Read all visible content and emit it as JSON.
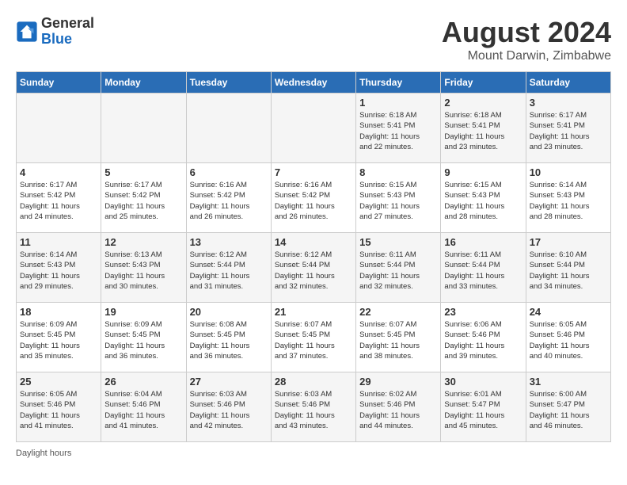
{
  "header": {
    "logo_general": "General",
    "logo_blue": "Blue",
    "month_year": "August 2024",
    "location": "Mount Darwin, Zimbabwe"
  },
  "columns": [
    "Sunday",
    "Monday",
    "Tuesday",
    "Wednesday",
    "Thursday",
    "Friday",
    "Saturday"
  ],
  "weeks": [
    [
      {
        "day": "",
        "info": ""
      },
      {
        "day": "",
        "info": ""
      },
      {
        "day": "",
        "info": ""
      },
      {
        "day": "",
        "info": ""
      },
      {
        "day": "1",
        "info": "Sunrise: 6:18 AM\nSunset: 5:41 PM\nDaylight: 11 hours\nand 22 minutes."
      },
      {
        "day": "2",
        "info": "Sunrise: 6:18 AM\nSunset: 5:41 PM\nDaylight: 11 hours\nand 23 minutes."
      },
      {
        "day": "3",
        "info": "Sunrise: 6:17 AM\nSunset: 5:41 PM\nDaylight: 11 hours\nand 23 minutes."
      }
    ],
    [
      {
        "day": "4",
        "info": "Sunrise: 6:17 AM\nSunset: 5:42 PM\nDaylight: 11 hours\nand 24 minutes."
      },
      {
        "day": "5",
        "info": "Sunrise: 6:17 AM\nSunset: 5:42 PM\nDaylight: 11 hours\nand 25 minutes."
      },
      {
        "day": "6",
        "info": "Sunrise: 6:16 AM\nSunset: 5:42 PM\nDaylight: 11 hours\nand 26 minutes."
      },
      {
        "day": "7",
        "info": "Sunrise: 6:16 AM\nSunset: 5:42 PM\nDaylight: 11 hours\nand 26 minutes."
      },
      {
        "day": "8",
        "info": "Sunrise: 6:15 AM\nSunset: 5:43 PM\nDaylight: 11 hours\nand 27 minutes."
      },
      {
        "day": "9",
        "info": "Sunrise: 6:15 AM\nSunset: 5:43 PM\nDaylight: 11 hours\nand 28 minutes."
      },
      {
        "day": "10",
        "info": "Sunrise: 6:14 AM\nSunset: 5:43 PM\nDaylight: 11 hours\nand 28 minutes."
      }
    ],
    [
      {
        "day": "11",
        "info": "Sunrise: 6:14 AM\nSunset: 5:43 PM\nDaylight: 11 hours\nand 29 minutes."
      },
      {
        "day": "12",
        "info": "Sunrise: 6:13 AM\nSunset: 5:43 PM\nDaylight: 11 hours\nand 30 minutes."
      },
      {
        "day": "13",
        "info": "Sunrise: 6:12 AM\nSunset: 5:44 PM\nDaylight: 11 hours\nand 31 minutes."
      },
      {
        "day": "14",
        "info": "Sunrise: 6:12 AM\nSunset: 5:44 PM\nDaylight: 11 hours\nand 32 minutes."
      },
      {
        "day": "15",
        "info": "Sunrise: 6:11 AM\nSunset: 5:44 PM\nDaylight: 11 hours\nand 32 minutes."
      },
      {
        "day": "16",
        "info": "Sunrise: 6:11 AM\nSunset: 5:44 PM\nDaylight: 11 hours\nand 33 minutes."
      },
      {
        "day": "17",
        "info": "Sunrise: 6:10 AM\nSunset: 5:44 PM\nDaylight: 11 hours\nand 34 minutes."
      }
    ],
    [
      {
        "day": "18",
        "info": "Sunrise: 6:09 AM\nSunset: 5:45 PM\nDaylight: 11 hours\nand 35 minutes."
      },
      {
        "day": "19",
        "info": "Sunrise: 6:09 AM\nSunset: 5:45 PM\nDaylight: 11 hours\nand 36 minutes."
      },
      {
        "day": "20",
        "info": "Sunrise: 6:08 AM\nSunset: 5:45 PM\nDaylight: 11 hours\nand 36 minutes."
      },
      {
        "day": "21",
        "info": "Sunrise: 6:07 AM\nSunset: 5:45 PM\nDaylight: 11 hours\nand 37 minutes."
      },
      {
        "day": "22",
        "info": "Sunrise: 6:07 AM\nSunset: 5:45 PM\nDaylight: 11 hours\nand 38 minutes."
      },
      {
        "day": "23",
        "info": "Sunrise: 6:06 AM\nSunset: 5:46 PM\nDaylight: 11 hours\nand 39 minutes."
      },
      {
        "day": "24",
        "info": "Sunrise: 6:05 AM\nSunset: 5:46 PM\nDaylight: 11 hours\nand 40 minutes."
      }
    ],
    [
      {
        "day": "25",
        "info": "Sunrise: 6:05 AM\nSunset: 5:46 PM\nDaylight: 11 hours\nand 41 minutes."
      },
      {
        "day": "26",
        "info": "Sunrise: 6:04 AM\nSunset: 5:46 PM\nDaylight: 11 hours\nand 41 minutes."
      },
      {
        "day": "27",
        "info": "Sunrise: 6:03 AM\nSunset: 5:46 PM\nDaylight: 11 hours\nand 42 minutes."
      },
      {
        "day": "28",
        "info": "Sunrise: 6:03 AM\nSunset: 5:46 PM\nDaylight: 11 hours\nand 43 minutes."
      },
      {
        "day": "29",
        "info": "Sunrise: 6:02 AM\nSunset: 5:46 PM\nDaylight: 11 hours\nand 44 minutes."
      },
      {
        "day": "30",
        "info": "Sunrise: 6:01 AM\nSunset: 5:47 PM\nDaylight: 11 hours\nand 45 minutes."
      },
      {
        "day": "31",
        "info": "Sunrise: 6:00 AM\nSunset: 5:47 PM\nDaylight: 11 hours\nand 46 minutes."
      }
    ]
  ],
  "footer": {
    "note": "Daylight hours"
  }
}
